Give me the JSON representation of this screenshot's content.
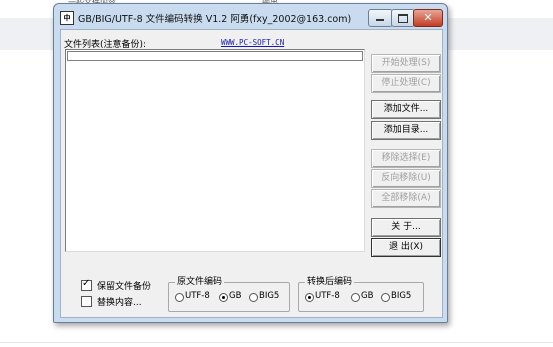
{
  "background": {
    "top_texts": [
      "一些文件内容...",
      "输出"
    ]
  },
  "window": {
    "title": "GB/BIG/UTF-8 文件编码转换 V1.2  阿勇(fxy_2002@163.com)",
    "icon_text": "中",
    "close_glyph": "✕"
  },
  "main": {
    "file_list_label": "文件列表(注意备份):",
    "website": "WWW.PC-SOFT.CN"
  },
  "buttons": {
    "start": "开始处理(S)",
    "stop": "停止处理(C)",
    "add_file": "添加文件...",
    "add_dir": "添加目录...",
    "remove_selected": "移除选择(E)",
    "remove_inverse": "反向移除(U)",
    "remove_all": "全部移除(A)",
    "about": "关  于...",
    "exit": "退  出(X)"
  },
  "options": {
    "keep_backup": {
      "label": "保留文件备份",
      "checked": true,
      "mark": "✓"
    },
    "replace_content": {
      "label": "替换内容...",
      "checked": false
    }
  },
  "source_encoding": {
    "title": "原文件编码",
    "options": [
      "UTF-8",
      "GB",
      "BIG5"
    ],
    "selected": "GB"
  },
  "target_encoding": {
    "title": "转换后编码",
    "options": [
      "UTF-8",
      "GB",
      "BIG5"
    ],
    "selected": "UTF-8"
  }
}
